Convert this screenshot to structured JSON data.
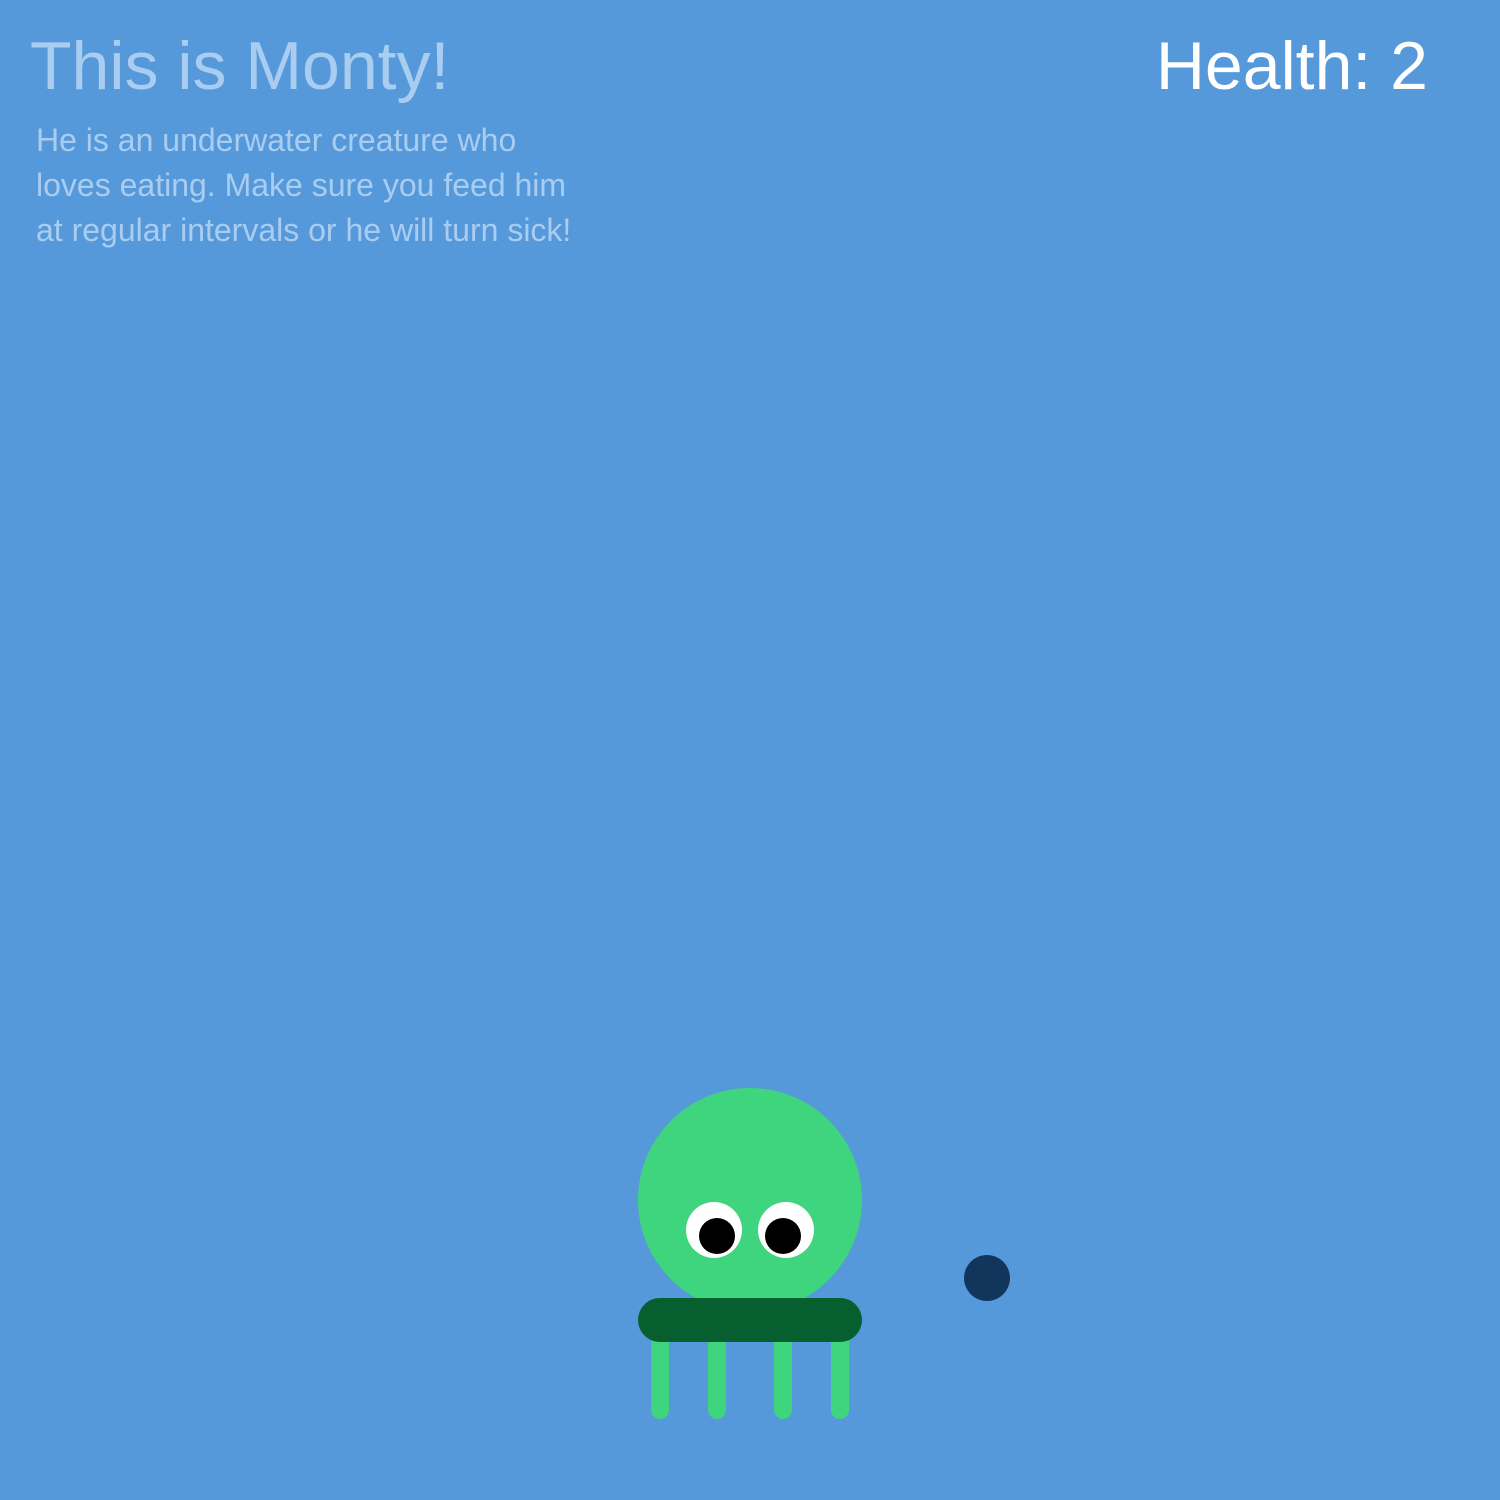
{
  "header": {
    "title": "This is Monty!",
    "description": "He is an underwater creature who loves eating. Make sure you feed him at regular intervals or he will turn sick!"
  },
  "status": {
    "health_text": "Health: 2"
  },
  "colors": {
    "background": "#5699db",
    "caption_text": "#a9cdf1",
    "health_text": "#ffffff",
    "creature_body": "#3fd47e",
    "creature_band": "#075e2f",
    "eye_white": "#ffffff",
    "pupil": "#000000",
    "food_pellet": "#12355c"
  },
  "icons": {
    "creature": "octopus-creature-icon",
    "food": "food-pellet-icon"
  }
}
